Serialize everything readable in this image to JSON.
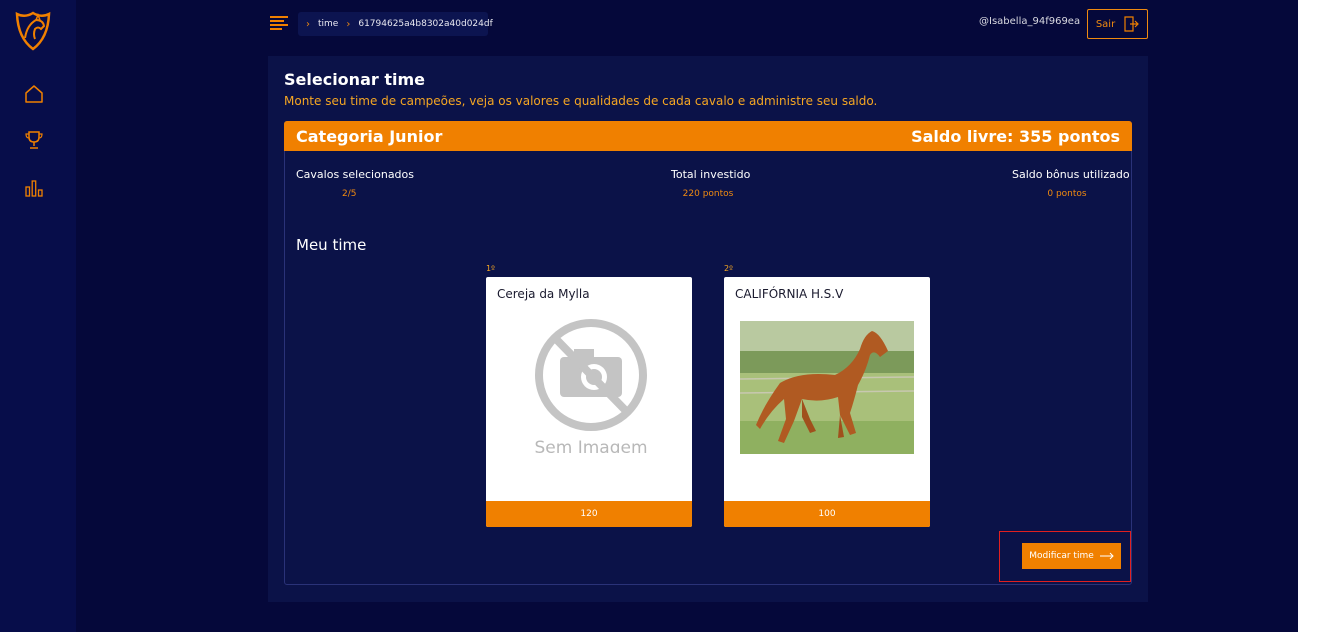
{
  "topbar": {
    "breadcrumb": [
      "time",
      "61794625a4b8302a40d024df"
    ],
    "user": "@Isabella_94f969ea",
    "logout_label": "Sair"
  },
  "page": {
    "title": "Selecionar time",
    "subtitle": "Monte seu time de campeões, veja os valores e qualidades de cada cavalo e administre seu saldo."
  },
  "category": {
    "name": "Categoria Junior",
    "balance": "Saldo livre: 355 pontos"
  },
  "stats": [
    {
      "label": "Cavalos selecionados",
      "value": "2/5"
    },
    {
      "label": "Total investido",
      "value": "220 pontos"
    },
    {
      "label": "Saldo bônus utilizado",
      "value": "0 pontos"
    }
  ],
  "team": {
    "title": "Meu time",
    "horses": [
      {
        "rank": "1º",
        "name": "Cereja da Mylla",
        "image_text": "Sem Imagem",
        "price": "120"
      },
      {
        "rank": "2º",
        "name": "CALIFÓRNIA H.S.V",
        "price": "100"
      }
    ]
  },
  "actions": {
    "modify_label": "Modificar time"
  },
  "colors": {
    "accent": "#f08000",
    "background": "#05083a",
    "panel": "#0b1248",
    "subtitle": "#f5a623"
  },
  "icons": [
    "horse-logo-icon",
    "home-icon",
    "trophy-icon",
    "bar-chart-icon",
    "menu-icon",
    "chevron-right-icon",
    "logout-icon",
    "arrow-right-icon",
    "no-camera-icon"
  ]
}
